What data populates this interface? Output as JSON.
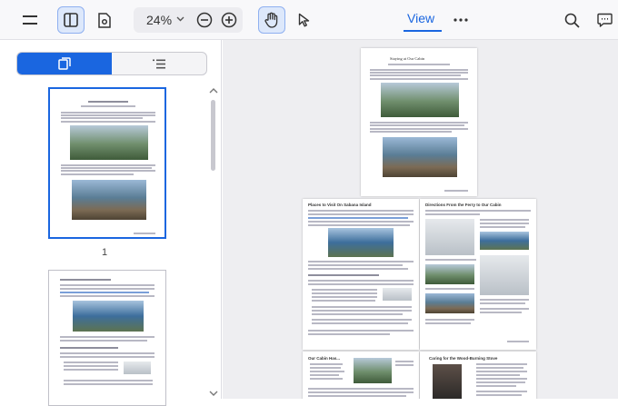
{
  "toolbar": {
    "zoom_value": "24%",
    "view_tab_label": "View"
  },
  "sidebar": {
    "selected_page_number": "1"
  },
  "doc": {
    "page1_title": "Staying at Our Cabin",
    "page2_title": "Places to Visit On Sabana Island",
    "page3_title": "Directions From the Ferry to Our Cabin",
    "page4_title": "Our Cabin Has...",
    "page5_title": "Caring for the Wood-Burning Stove"
  },
  "colors": {
    "accent": "#1a66e0",
    "canvas_bg": "#eeeef1"
  }
}
